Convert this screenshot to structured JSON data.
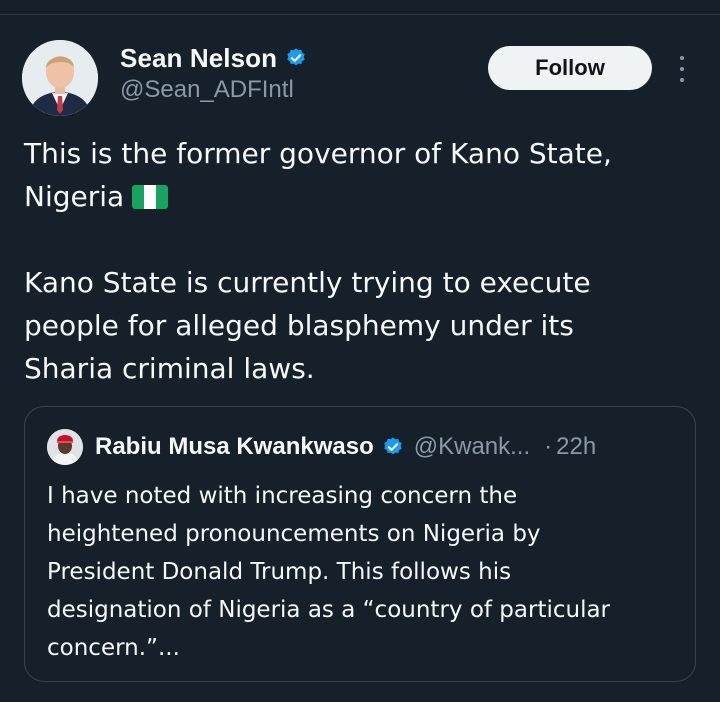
{
  "tweet": {
    "author": {
      "name": "Sean Nelson",
      "handle": "@Sean_ADFIntl",
      "verified": true
    },
    "follow_label": "Follow",
    "text_lines": [
      "This is the former governor of Kano State,",
      "Nigeria",
      "",
      "Kano State is currently trying to execute",
      "people for alleged blasphemy under its",
      "Sharia criminal laws."
    ],
    "flag_icon": "nigeria-flag-icon"
  },
  "quoted_tweet": {
    "author": {
      "name": "Rabiu Musa Kwankwaso",
      "handle": "@Kwank...",
      "verified": true
    },
    "separator": "·",
    "time": "22h",
    "text_lines": [
      "I have noted with increasing concern the",
      "heightened pronouncements on Nigeria by",
      "President Donald Trump. This follows his",
      "designation of Nigeria as a “country of particular",
      "concern.”..."
    ]
  },
  "colors": {
    "background": "#15202b",
    "text": "#f7f9f9",
    "muted": "#8b98a5",
    "verified": "#1d9bf0",
    "border": "#38444d"
  }
}
